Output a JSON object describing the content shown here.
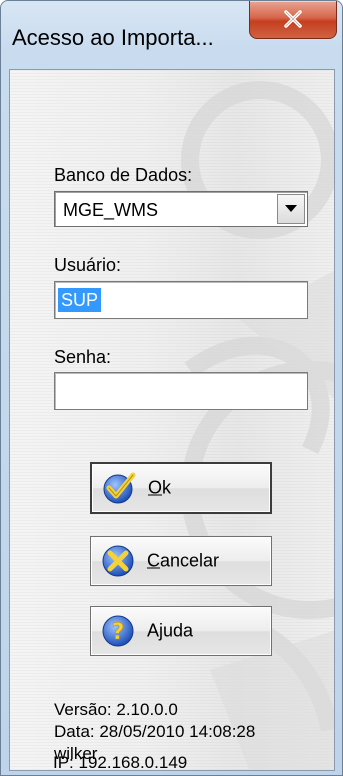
{
  "window": {
    "title": "Acesso ao Importa..."
  },
  "form": {
    "database_label": "Banco de Dados:",
    "database_value": "MGE_WMS",
    "user_label": "Usuário:",
    "user_value": "SUP",
    "password_label": "Senha:",
    "password_value": ""
  },
  "buttons": {
    "ok": {
      "label": "Ok",
      "accel": "O",
      "rest": "k",
      "icon": "check-icon"
    },
    "cancel": {
      "label": "Cancelar",
      "accel": "C",
      "rest": "ancelar",
      "icon": "cancel-x-icon"
    },
    "help": {
      "label": "Ajuda",
      "pre": "A",
      "accel": "j",
      "rest": "uda",
      "icon": "question-icon"
    }
  },
  "info": {
    "version": "Versão: 2.10.0.0",
    "date": "Data: 28/05/2010 14:08:28",
    "user": "wilker",
    "ip": "IP: 192.168.0.149"
  },
  "colors": {
    "title_bg": "#c9dcef",
    "close_button": "#c43f1f",
    "selection": "#3399ff"
  }
}
